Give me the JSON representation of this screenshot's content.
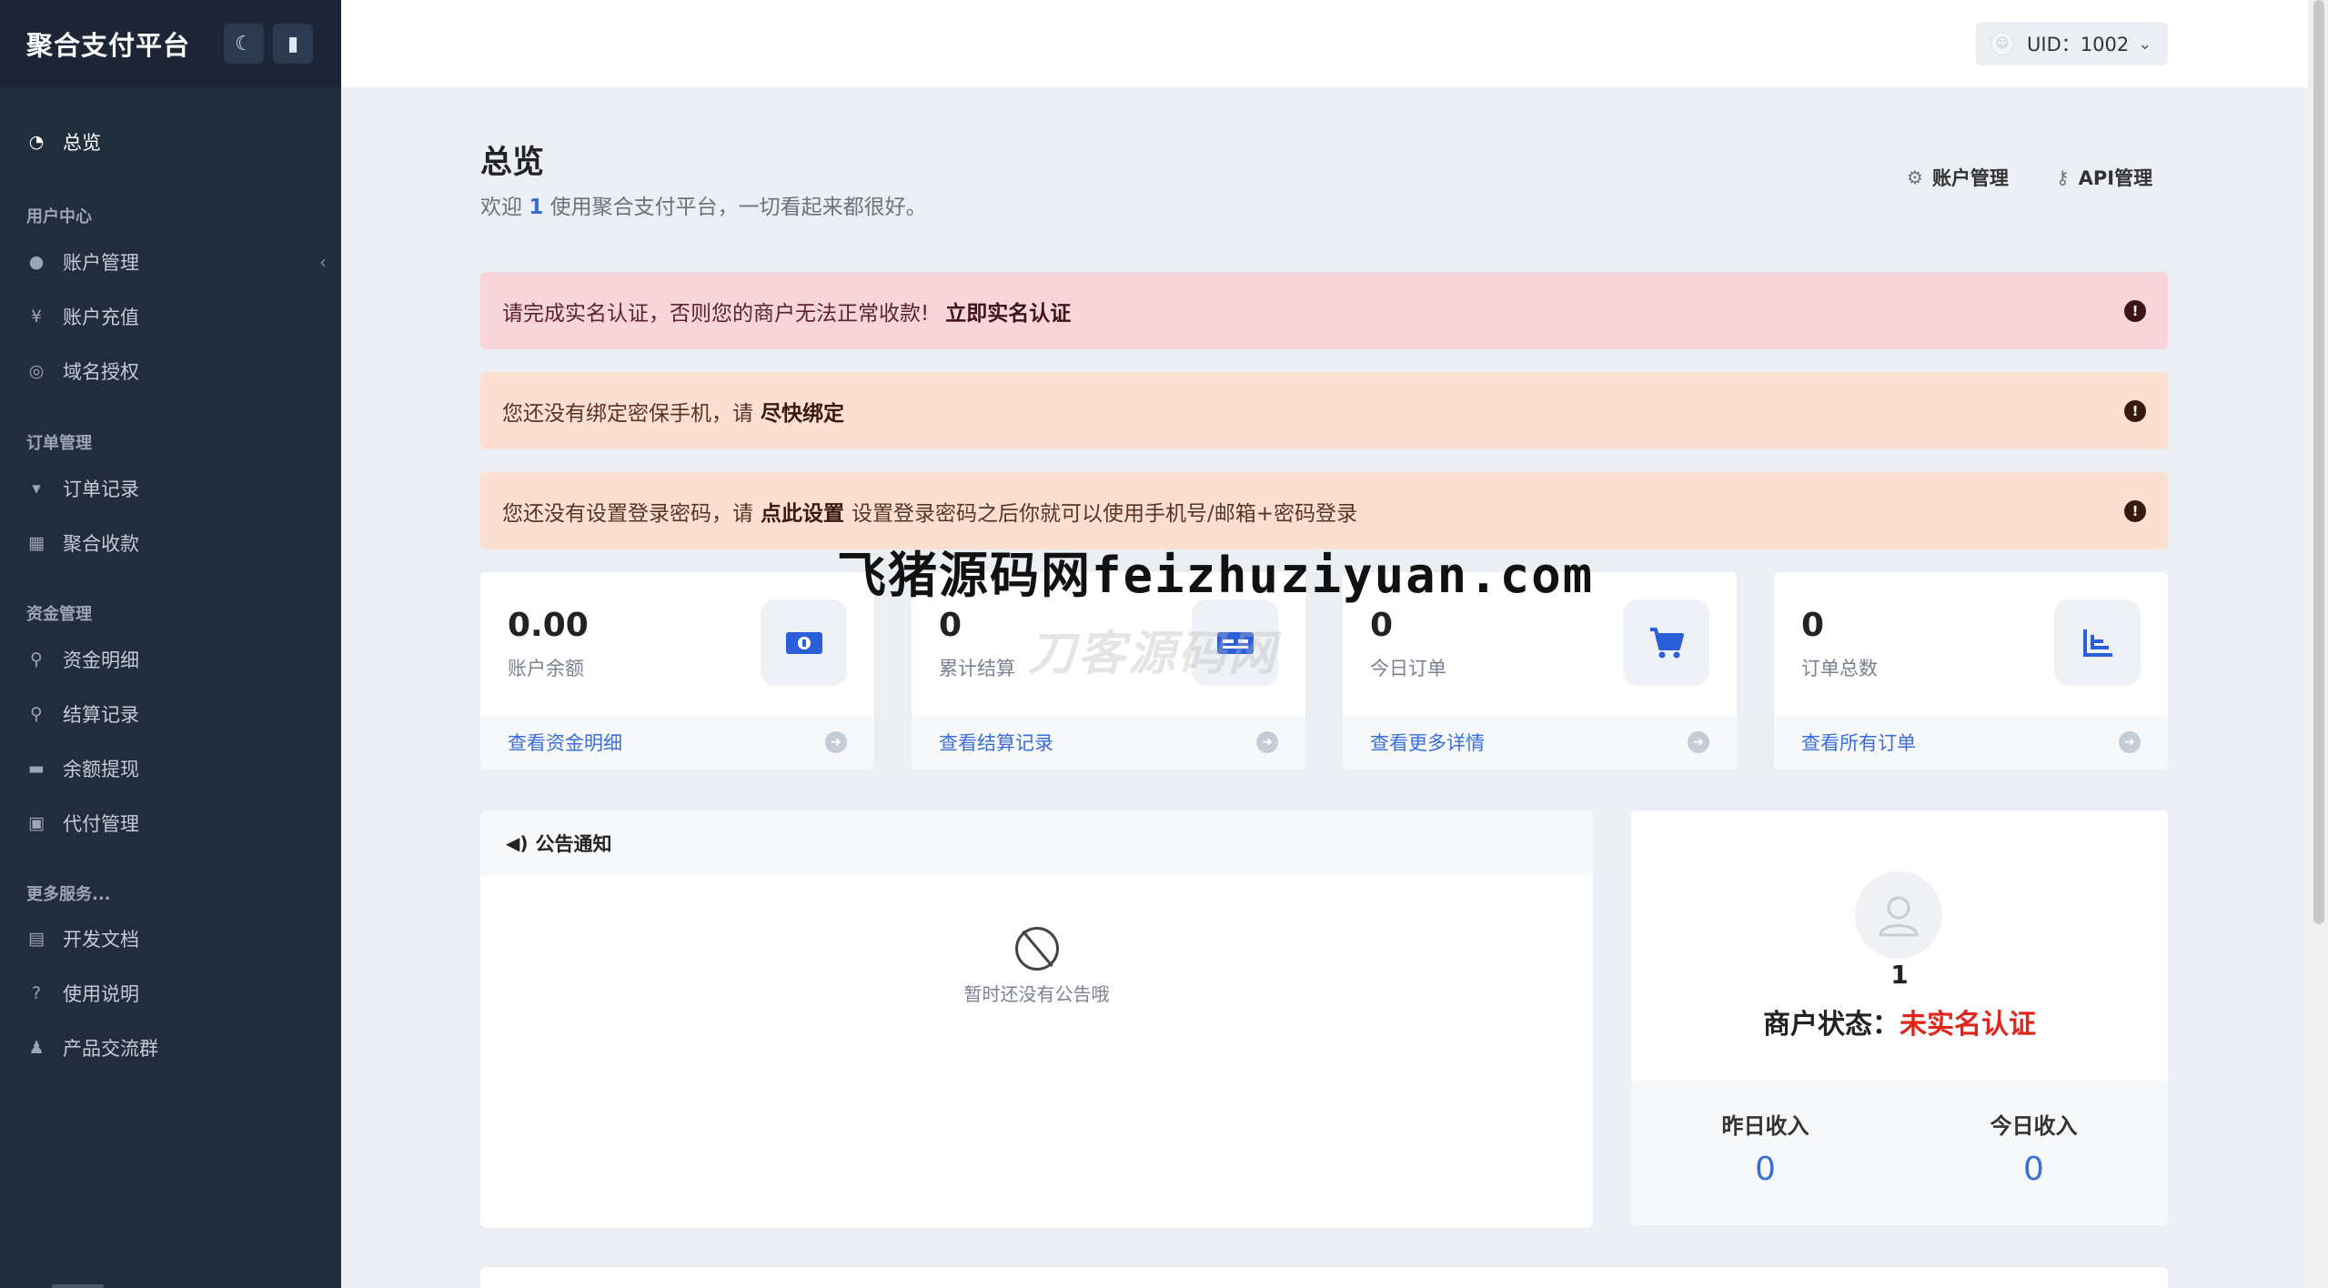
{
  "sidebar": {
    "brand": "聚合支付平台",
    "items": {
      "overview": "总览",
      "user_center": "用户中心",
      "account_manage": "账户管理",
      "account_recharge": "账户充值",
      "domain_auth": "域名授权",
      "order_manage": "订单管理",
      "order_records": "订单记录",
      "aggregate_pay": "聚合收款",
      "fund_manage": "资金管理",
      "fund_details": "资金明细",
      "settlement_records": "结算记录",
      "balance_withdraw": "余额提现",
      "payout_manage": "代付管理",
      "more_services": "更多服务...",
      "dev_docs": "开发文档",
      "usage_guide": "使用说明",
      "product_group": "产品交流群"
    }
  },
  "header": {
    "uid": "UID：1002"
  },
  "page": {
    "title": "总览",
    "welcome_prefix": "欢迎 ",
    "welcome_num": "1",
    "welcome_suffix": " 使用聚合支付平台，一切看起来都很好。",
    "link_account": "账户管理",
    "link_api": "API管理"
  },
  "alerts": {
    "realname_text": "请完成实名认证，否则您的商户无法正常收款!",
    "realname_link": "立即实名认证",
    "phone_text": "您还没有绑定密保手机，请",
    "phone_link": "尽快绑定",
    "pwd_text": "您还没有设置登录密码，请",
    "pwd_link": "点此设置",
    "pwd_tail": "设置登录密码之后你就可以使用手机号/邮箱+密码登录"
  },
  "stats": [
    {
      "value": "0.00",
      "label": "账户余额",
      "link": "查看资金明细"
    },
    {
      "value": "0",
      "label": "累计结算",
      "link": "查看结算记录"
    },
    {
      "value": "0",
      "label": "今日订单",
      "link": "查看更多详情"
    },
    {
      "value": "0",
      "label": "订单总数",
      "link": "查看所有订单"
    }
  ],
  "notice": {
    "title": "公告通知",
    "empty": "暂时还没有公告哦"
  },
  "profile": {
    "name": "1",
    "status_label": "商户状态：",
    "status_value": "未实名认证",
    "yesterday_label": "昨日收入",
    "yesterday_value": "0",
    "today_label": "今日收入",
    "today_value": "0"
  },
  "watermark": {
    "main": "飞猪源码网feizhuziyuan.com",
    "faint": "刀客源码网"
  },
  "colors": {
    "sidebar": "#212c3d",
    "accent": "#3b6ed8",
    "danger_alert": "#f8d4db",
    "warn_alert": "#fbe0d2",
    "status_red": "#e0261b"
  }
}
